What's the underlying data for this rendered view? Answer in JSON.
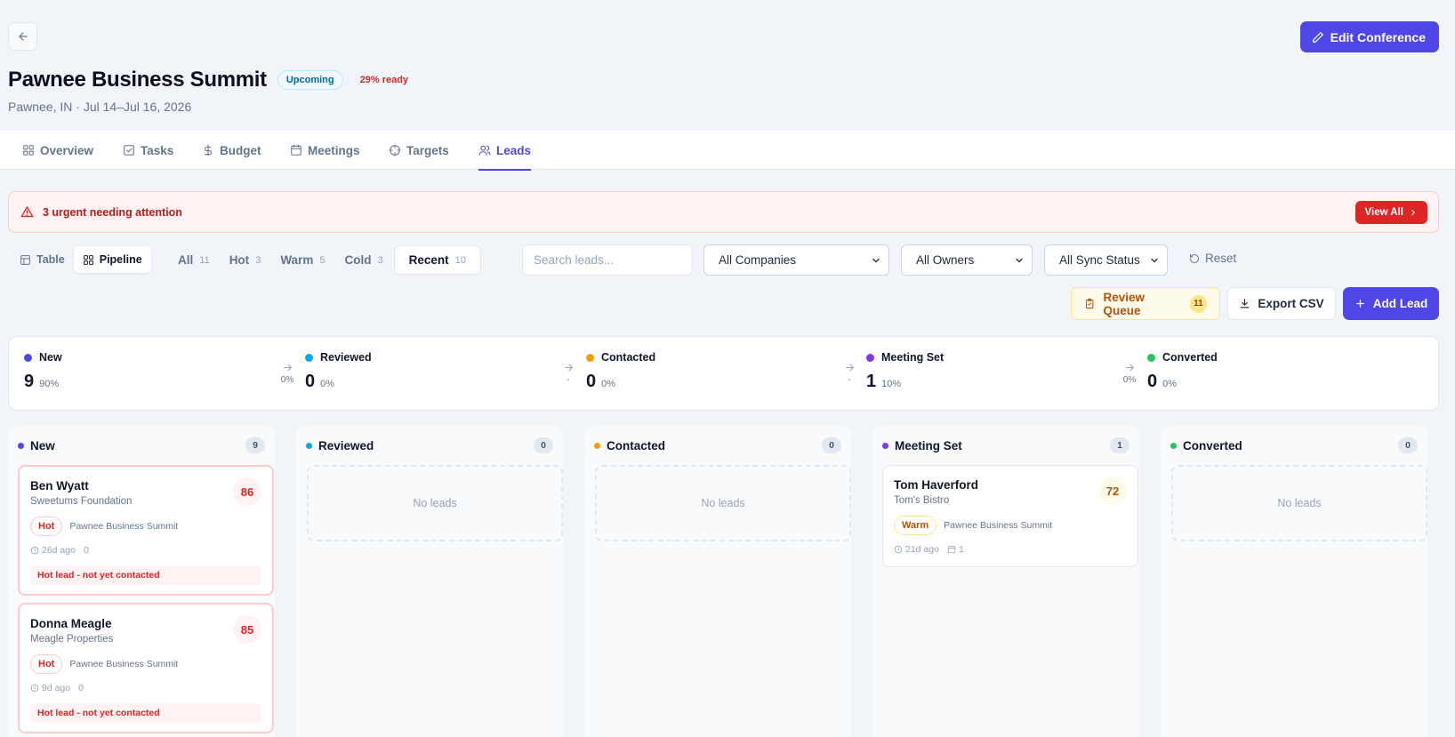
{
  "header": {
    "title": "Pawnee Business Summit",
    "status_badge": "Upcoming",
    "readiness": "29% ready",
    "subtitle": "Pawnee, IN · Jul 14–Jul 16, 2026",
    "edit_label": "Edit Conference"
  },
  "tabs": [
    {
      "label": "Overview",
      "icon": "grid-icon"
    },
    {
      "label": "Tasks",
      "icon": "checkbox-icon"
    },
    {
      "label": "Budget",
      "icon": "dollar-icon"
    },
    {
      "label": "Meetings",
      "icon": "calendar-icon"
    },
    {
      "label": "Targets",
      "icon": "crosshair-icon"
    },
    {
      "label": "Leads",
      "icon": "users-icon",
      "active": true
    }
  ],
  "alert": {
    "text": "3 urgent needing attention",
    "button": "View All"
  },
  "view_toggle": {
    "table": "Table",
    "pipeline": "Pipeline",
    "active": "Pipeline"
  },
  "filters": [
    {
      "label": "All",
      "count": "11"
    },
    {
      "label": "Hot",
      "count": "3"
    },
    {
      "label": "Warm",
      "count": "5"
    },
    {
      "label": "Cold",
      "count": "3"
    },
    {
      "label": "Recent",
      "count": "10",
      "active": true
    }
  ],
  "search": {
    "placeholder": "Search leads..."
  },
  "selects": {
    "companies": "All Companies",
    "owners": "All Owners",
    "sync": "All Sync Status"
  },
  "reset_label": "Reset",
  "actions": {
    "review_queue": "Review Queue",
    "review_count": "11",
    "export": "Export CSV",
    "add": "Add Lead"
  },
  "summary": [
    {
      "name": "New",
      "count": "9",
      "percent": "90%",
      "color": "#4f46e5"
    },
    {
      "name": "Reviewed",
      "count": "0",
      "percent": "0%",
      "color": "#0ea5e9"
    },
    {
      "name": "Contacted",
      "count": "0",
      "percent": "0%",
      "color": "#f59e0b"
    },
    {
      "name": "Meeting Set",
      "count": "1",
      "percent": "10%",
      "color": "#7c3aed"
    },
    {
      "name": "Converted",
      "count": "0",
      "percent": "0%",
      "color": "#22c55e"
    }
  ],
  "conversions": [
    "0%",
    "-",
    "-",
    "0%"
  ],
  "columns": [
    {
      "name": "New",
      "count": "9",
      "color": "#4f46e5"
    },
    {
      "name": "Reviewed",
      "count": "0",
      "color": "#0ea5e9",
      "empty": "No leads"
    },
    {
      "name": "Contacted",
      "count": "0",
      "color": "#f59e0b",
      "empty": "No leads"
    },
    {
      "name": "Meeting Set",
      "count": "1",
      "color": "#7c3aed"
    },
    {
      "name": "Converted",
      "count": "0",
      "color": "#22c55e",
      "empty": "No leads"
    }
  ],
  "cards": {
    "ben": {
      "name": "Ben Wyatt",
      "company": "Sweetums Foundation",
      "score": "86",
      "temp": "Hot",
      "conference": "Pawnee Business Summit",
      "age": "26d ago",
      "meetings": "0",
      "warning": "Hot lead - not yet contacted"
    },
    "donna": {
      "name": "Donna Meagle",
      "company": "Meagle Properties",
      "score": "85",
      "temp": "Hot",
      "conference": "Pawnee Business Summit",
      "age": "9d ago",
      "meetings": "0",
      "warning": "Hot lead - not yet contacted"
    },
    "tom": {
      "name": "Tom Haverford",
      "company": "Tom's Bistro",
      "score": "72",
      "temp": "Warm",
      "conference": "Pawnee Business Summit",
      "age": "21d ago",
      "meetings": "1"
    }
  }
}
